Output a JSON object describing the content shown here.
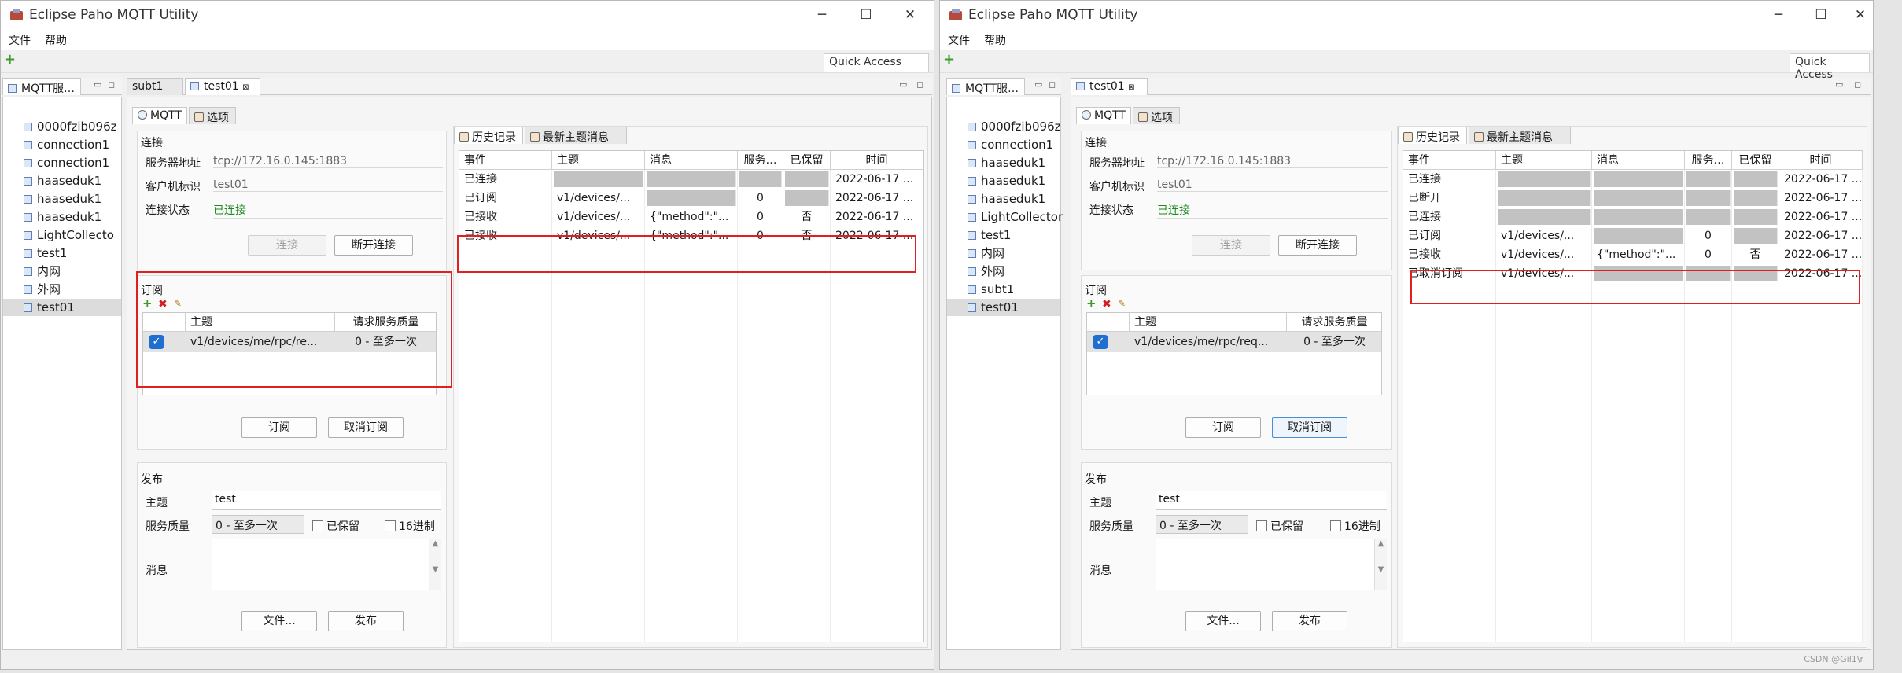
{
  "app_title": "Eclipse Paho MQTT Utility",
  "menu": {
    "file": "文件",
    "help": "帮助"
  },
  "quick_access": "Quick Access",
  "watermark": "CSDN @Gil1\\r",
  "left": {
    "tab_tree": "MQTT服…",
    "tab_subt1": "subt1",
    "tab_test01": "test01",
    "tree": [
      "0000fzib096z",
      "connection1",
      "connection1",
      "haaseduk1",
      "haaseduk1",
      "haaseduk1",
      "LightCollecto",
      "test1",
      "内网",
      "外网",
      "test01"
    ],
    "subtabs": {
      "mqtt": "MQTT",
      "options": "选项"
    },
    "conn": {
      "title": "连接",
      "server_label": "服务器地址",
      "server": "tcp://172.16.0.145:1883",
      "client_label": "客户机标识",
      "client": "test01",
      "status_label": "连接状态",
      "status": "已连接",
      "connect_btn": "连接",
      "disconnect_btn": "断开连接"
    },
    "sub": {
      "title": "订阅",
      "col_topic": "主题",
      "col_qos": "请求服务质量",
      "row_topic": "v1/devices/me/rpc/re...",
      "row_qos": "0 - 至多一次",
      "sub_btn": "订阅",
      "unsub_btn": "取消订阅"
    },
    "pub": {
      "title": "发布",
      "topic_label": "主题",
      "topic": "test",
      "qos_label": "服务质量",
      "qos": "0 - 至多一次",
      "retain": "已保留",
      "hex": "16进制",
      "msg_label": "消息",
      "file_btn": "文件...",
      "pub_btn": "发布"
    },
    "hist_tabs": {
      "history": "历史记录",
      "latest": "最新主题消息"
    },
    "cols": [
      "事件",
      "主题",
      "消息",
      "服务…",
      "已保留",
      "时间"
    ],
    "rows": [
      {
        "event": "已连接",
        "topic": "",
        "msg": "",
        "qos": "",
        "ret": "",
        "time": "2022-06-17 ..."
      },
      {
        "event": "已订阅",
        "topic": "v1/devices/...",
        "msg": "",
        "qos": "0",
        "ret": "",
        "time": "2022-06-17 ..."
      },
      {
        "event": "已接收",
        "topic": "v1/devices/...",
        "msg": "{\"method\":\"...",
        "qos": "0",
        "ret": "否",
        "time": "2022-06-17 ..."
      },
      {
        "event": "已接收",
        "topic": "v1/devices/...",
        "msg": "{\"method\":\"...",
        "qos": "0",
        "ret": "否",
        "time": "2022-06-17 ..."
      }
    ]
  },
  "right": {
    "tab_tree": "MQTT服…",
    "tab_test01": "test01",
    "tree": [
      "0000fzib096z",
      "connection1",
      "haaseduk1",
      "haaseduk1",
      "haaseduk1",
      "LightCollector",
      "test1",
      "内网",
      "外网",
      "subt1",
      "test01"
    ],
    "subtabs": {
      "mqtt": "MQTT",
      "options": "选项"
    },
    "conn": {
      "title": "连接",
      "server_label": "服务器地址",
      "server": "tcp://172.16.0.145:1883",
      "client_label": "客户机标识",
      "client": "test01",
      "status_label": "连接状态",
      "status": "已连接",
      "connect_btn": "连接",
      "disconnect_btn": "断开连接"
    },
    "sub": {
      "title": "订阅",
      "col_topic": "主题",
      "col_qos": "请求服务质量",
      "row_topic": "v1/devices/me/rpc/req...",
      "row_qos": "0 - 至多一次",
      "sub_btn": "订阅",
      "unsub_btn": "取消订阅"
    },
    "pub": {
      "title": "发布",
      "topic_label": "主题",
      "topic": "test",
      "qos_label": "服务质量",
      "qos": "0 - 至多一次",
      "retain": "已保留",
      "hex": "16进制",
      "msg_label": "消息",
      "file_btn": "文件...",
      "pub_btn": "发布"
    },
    "hist_tabs": {
      "history": "历史记录",
      "latest": "最新主题消息"
    },
    "cols": [
      "事件",
      "主题",
      "消息",
      "服务…",
      "已保留",
      "时间"
    ],
    "rows": [
      {
        "event": "已连接",
        "topic": "",
        "msg": "",
        "qos": "",
        "ret": "",
        "time": "2022-06-17 ..."
      },
      {
        "event": "已断开",
        "topic": "",
        "msg": "",
        "qos": "",
        "ret": "",
        "time": "2022-06-17 ..."
      },
      {
        "event": "已连接",
        "topic": "",
        "msg": "",
        "qos": "",
        "ret": "",
        "time": "2022-06-17 ..."
      },
      {
        "event": "已订阅",
        "topic": "v1/devices/...",
        "msg": "",
        "qos": "0",
        "ret": "",
        "time": "2022-06-17 ..."
      },
      {
        "event": "已接收",
        "topic": "v1/devices/...",
        "msg": "{\"method\":\"...",
        "qos": "0",
        "ret": "否",
        "time": "2022-06-17 ..."
      },
      {
        "event": "已取消订阅",
        "topic": "v1/devices/...",
        "msg": "",
        "qos": "",
        "ret": "",
        "time": "2022-06-17 ..."
      }
    ]
  }
}
